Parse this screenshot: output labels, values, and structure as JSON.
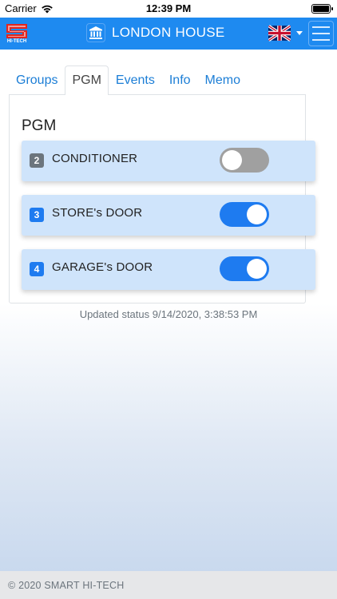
{
  "status_bar": {
    "carrier": "Carrier",
    "time": "12:39 PM"
  },
  "navbar": {
    "title": "LONDON HOUSE",
    "logo_caption": "HI-TECH",
    "colors": {
      "bar": "#1e8af0",
      "text": "#ffffff"
    }
  },
  "tabs": [
    {
      "label": "Groups"
    },
    {
      "label": "PGM"
    },
    {
      "label": "Events"
    },
    {
      "label": "Info"
    },
    {
      "label": "Memo"
    }
  ],
  "active_tab": "PGM",
  "card": {
    "title": "PGM",
    "items": [
      {
        "number": "2",
        "name": "CONDITIONER",
        "enabled": false,
        "badge_color": "#6c757d"
      },
      {
        "number": "3",
        "name": "STORE's DOOR",
        "enabled": true,
        "badge_color": "#1e7bf0"
      },
      {
        "number": "4",
        "name": "GARAGE's DOOR",
        "enabled": true,
        "badge_color": "#1e7bf0"
      }
    ]
  },
  "updated_status": "Updated status 9/14/2020, 3:38:53 PM",
  "footer": "© 2020 SMART HI-TECH"
}
